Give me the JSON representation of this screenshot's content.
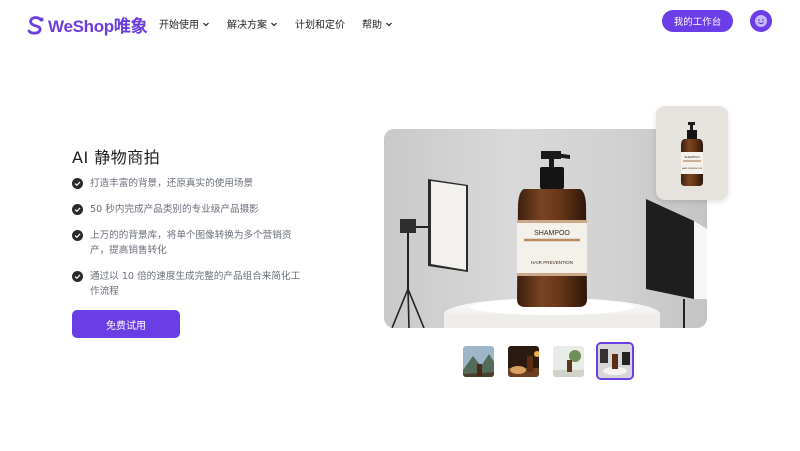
{
  "brand": {
    "name": "WeShop唯象",
    "accent": "#6a3de6"
  },
  "nav": {
    "items": [
      {
        "label": "开始使用",
        "has_dropdown": true
      },
      {
        "label": "解决方案",
        "has_dropdown": true
      },
      {
        "label": "计划和定价",
        "has_dropdown": false
      },
      {
        "label": "帮助",
        "has_dropdown": true
      }
    ],
    "workbench_label": "我的工作台"
  },
  "hero": {
    "title": "AI 静物商拍",
    "features": [
      "打造丰富的背景，还原真实的使用场景",
      "50 秒内完成产品类别的专业级产品摄影",
      "上万的的背景库，将单个图像转换为多个营销资产，提高销售转化",
      "通过以 10 倍的速度生成完整的产品组合来简化工作流程"
    ],
    "cta_label": "免费试用"
  },
  "product": {
    "bottle_label_top": "SHAMPOO",
    "bottle_label_bottom": "HAIR PREVENTION",
    "inset_label_top": "SHAMPOO",
    "inset_label_bottom": "HAIR PREVENTION"
  },
  "thumbnails": [
    {
      "name": "mountain-scene",
      "active": false
    },
    {
      "name": "food-table-scene",
      "active": false
    },
    {
      "name": "bathroom-scene",
      "active": false
    },
    {
      "name": "studio-scene",
      "active": true
    }
  ]
}
